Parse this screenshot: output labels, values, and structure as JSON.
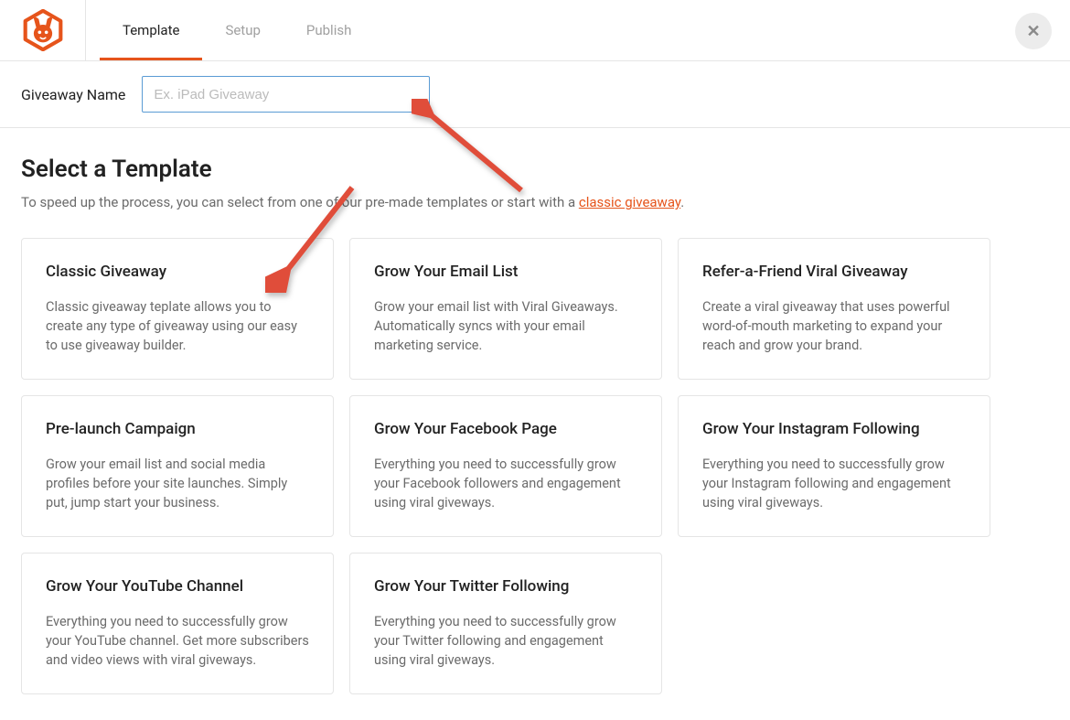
{
  "header": {
    "tabs": [
      {
        "label": "Template",
        "active": true
      },
      {
        "label": "Setup",
        "active": false
      },
      {
        "label": "Publish",
        "active": false
      }
    ]
  },
  "name_section": {
    "label": "Giveaway Name",
    "placeholder": "Ex. iPad Giveaway",
    "value": ""
  },
  "templates": {
    "title": "Select a Template",
    "intro_prefix": "To speed up the process, you can select from one of our pre-made templates or start with a ",
    "intro_link": "classic giveaway",
    "intro_suffix": ".",
    "cards": [
      {
        "title": "Classic Giveaway",
        "desc": "Classic giveaway teplate allows you to create any type of giveaway using our easy to use giveaway builder."
      },
      {
        "title": "Grow Your Email List",
        "desc": "Grow your email list with Viral Giveaways. Automatically syncs with your email marketing service."
      },
      {
        "title": "Refer-a-Friend Viral Giveaway",
        "desc": "Create a viral giveaway that uses powerful word-of-mouth marketing to expand your reach and grow your brand."
      },
      {
        "title": "Pre-launch Campaign",
        "desc": "Grow your email list and social media profiles before your site launches. Simply put, jump start your business."
      },
      {
        "title": "Grow Your Facebook Page",
        "desc": "Everything you need to successfully grow your Facebook followers and engagement using viral giveways."
      },
      {
        "title": "Grow Your Instagram Following",
        "desc": "Everything you need to successfully grow your Instagram following and engagement using viral giveways."
      },
      {
        "title": "Grow Your YouTube Channel",
        "desc": "Everything you need to successfully grow your YouTube channel. Get more subscribers and video views with viral giveways."
      },
      {
        "title": "Grow Your Twitter Following",
        "desc": "Everything you need to successfully grow your Twitter following and engagement using viral giveways."
      }
    ]
  },
  "colors": {
    "accent": "#e6541b",
    "arrow": "#e04d3a"
  }
}
